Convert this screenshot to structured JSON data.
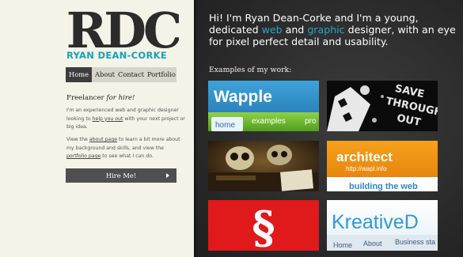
{
  "brand": {
    "logo_text": "RDC",
    "name": "RYAN DEAN-CORKE"
  },
  "nav": {
    "items": [
      "Home",
      "About",
      "Contact",
      "Portfolio"
    ],
    "active": "Home"
  },
  "sidebar": {
    "heading_prefix": "Freelancer ",
    "heading_emphasis": "for hire!",
    "para1_a": "I'm an experienced web and graphic designer looking to ",
    "para1_link": "help you out",
    "para1_b": " with your next project or big idea.",
    "para2_a": "View the ",
    "para2_link1": "about page",
    "para2_b": " to learn a bit more about my background and skills, and view the ",
    "para2_link2": "portfolio page",
    "para2_c": " to see what I can do.",
    "hire_button": "Hire Me!"
  },
  "intro": {
    "part1": "Hi! I'm Ryan Dean-Corke and I'm a young, dedicated ",
    "web": "web",
    "and": " and ",
    "graphic": "graphic",
    "part2": " designer, with an eye for pixel perfect detail and usability."
  },
  "portfolio": {
    "title": "Examples of my work:",
    "items": [
      {
        "name": "wapple-thumb",
        "logo": "Wapple",
        "tabs": [
          "home",
          "examples",
          "pro"
        ]
      },
      {
        "name": "shark-artwork-thumb",
        "text": [
          "SAVE",
          "THROUGH",
          "OUT"
        ]
      },
      {
        "name": "skull-artwork-thumb"
      },
      {
        "name": "wapl-thumb",
        "headline": "architect",
        "url": "http://wapl.info",
        "tagline": "building the web"
      },
      {
        "name": "section-sign-thumb",
        "glyph": "§"
      },
      {
        "name": "kreative-thumb",
        "logo": "KreativeD",
        "tabs": [
          "Home",
          "About",
          "Business sta"
        ]
      }
    ]
  },
  "colors": {
    "accent": "#1aa0b8",
    "dark_panel": "#2e2e2e",
    "light_panel": "#f4f3e8",
    "button": "#4f4f4f"
  }
}
